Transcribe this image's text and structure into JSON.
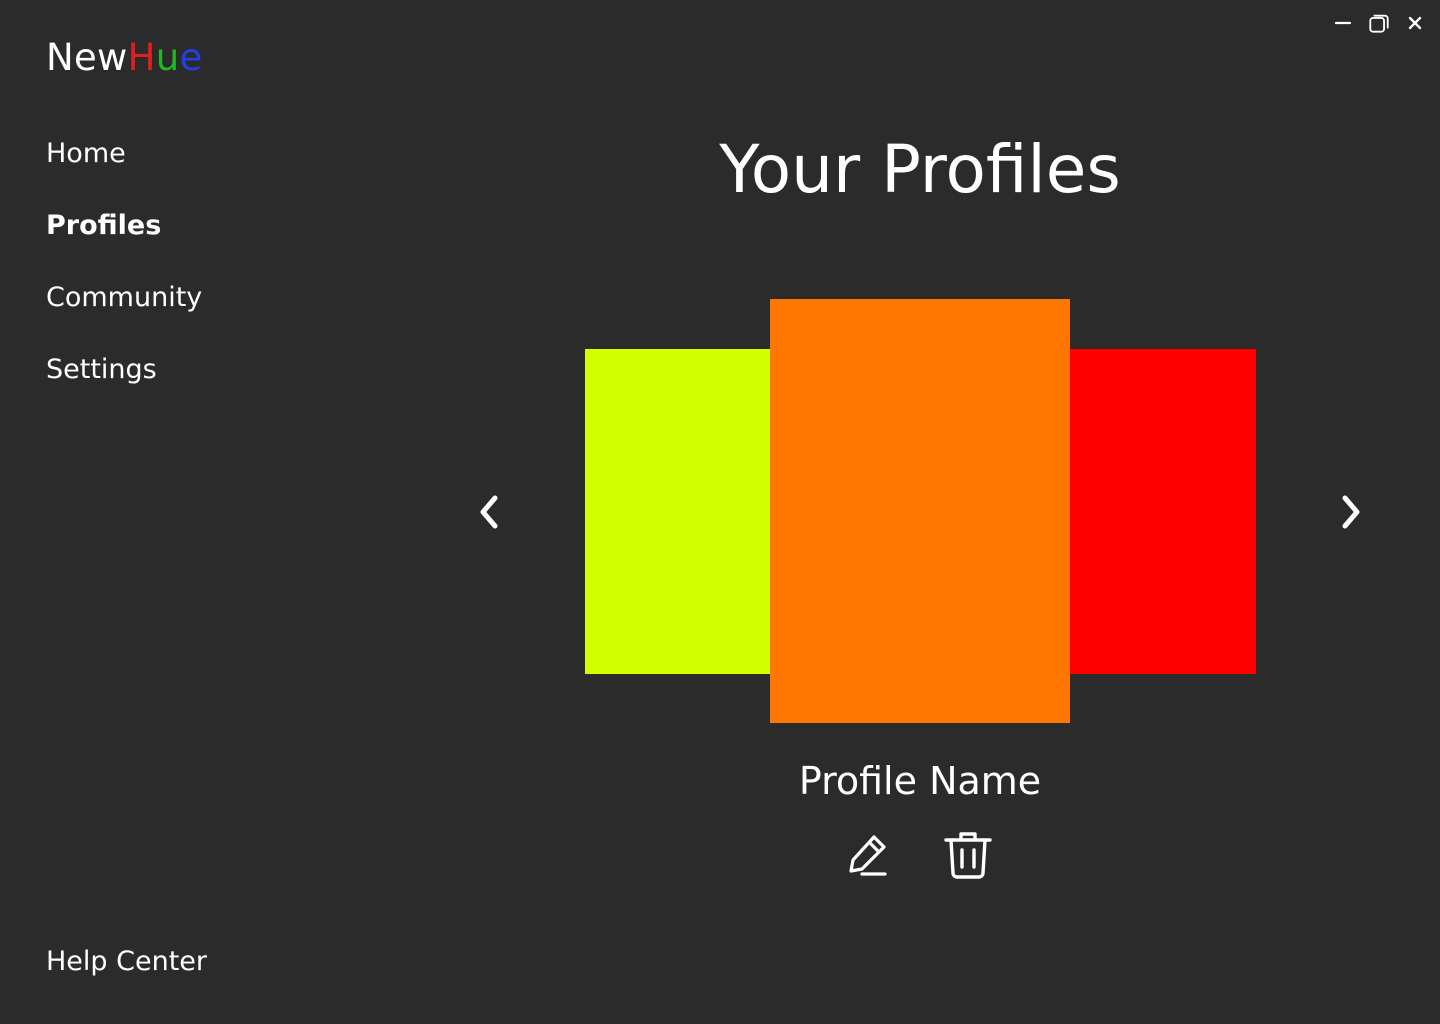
{
  "app": {
    "logo": {
      "part_new": "New",
      "part_h": "H",
      "part_u": "u",
      "part_e": "e",
      "colors": {
        "new": "#ffffff",
        "h": "#e02020",
        "u": "#22b822",
        "e": "#2040e0"
      }
    },
    "window_controls": {
      "minimize_icon": "minimize-icon",
      "restore_icon": "restore-icon",
      "close_icon": "close-icon"
    }
  },
  "sidebar": {
    "items": [
      {
        "label": "Home",
        "active": false
      },
      {
        "label": "Profiles",
        "active": true
      },
      {
        "label": "Community",
        "active": false
      },
      {
        "label": "Settings",
        "active": false
      }
    ],
    "help_center": "Help Center"
  },
  "main": {
    "title": "Your Profiles",
    "carousel": {
      "prev_icon": "chevron-left-icon",
      "next_icon": "chevron-right-icon",
      "cards": [
        {
          "position": "left",
          "color": "#d4ff00"
        },
        {
          "position": "center",
          "color": "#ff7700"
        },
        {
          "position": "right",
          "color": "#ff0000"
        }
      ]
    },
    "profile_name": "Profile Name",
    "actions": {
      "edit_icon": "pencil-icon",
      "delete_icon": "trash-icon"
    }
  },
  "colors": {
    "background": "#2b2b2b",
    "text": "#ffffff"
  }
}
